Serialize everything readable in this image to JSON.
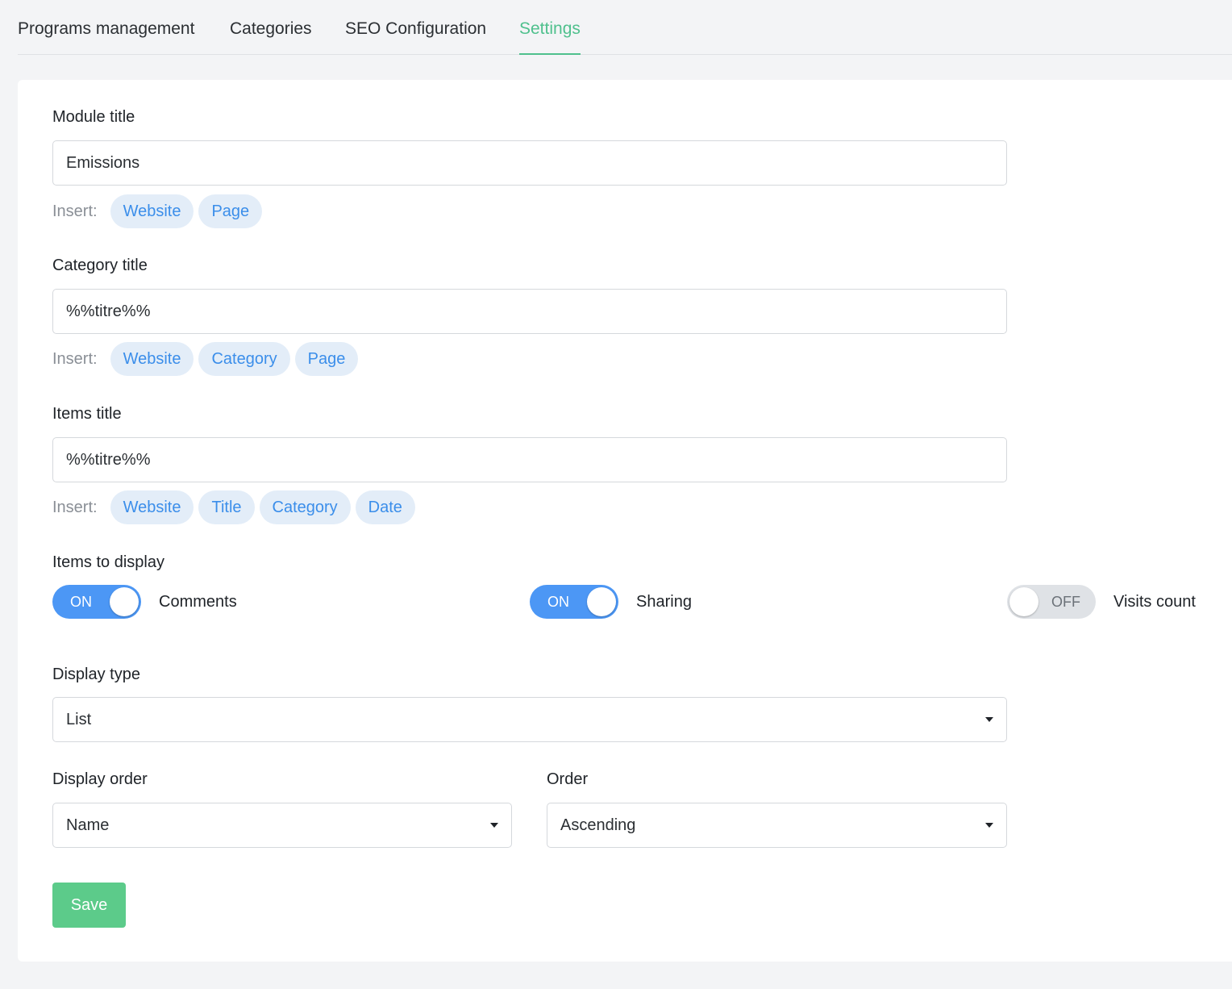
{
  "tabs": [
    {
      "label": "Programs management",
      "active": false
    },
    {
      "label": "Categories",
      "active": false
    },
    {
      "label": "SEO Configuration",
      "active": false
    },
    {
      "label": "Settings",
      "active": true
    }
  ],
  "colors": {
    "accent_green": "#4fc08d",
    "chip_bg": "#e3edf8",
    "chip_text": "#3b8eea",
    "toggle_on": "#4c97f5",
    "toggle_off": "#dfe2e6",
    "save_button": "#5ccb8a"
  },
  "form": {
    "module_title": {
      "label": "Module title",
      "value": "Emissions",
      "insert_label": "Insert:",
      "chips": [
        "Website",
        "Page"
      ]
    },
    "category_title": {
      "label": "Category title",
      "value": "%%titre%%",
      "insert_label": "Insert:",
      "chips": [
        "Website",
        "Category",
        "Page"
      ]
    },
    "items_title": {
      "label": "Items title",
      "value": "%%titre%%",
      "insert_label": "Insert:",
      "chips": [
        "Website",
        "Title",
        "Category",
        "Date"
      ]
    },
    "items_to_display": {
      "label": "Items to display",
      "toggles": [
        {
          "label": "Comments",
          "on": true,
          "state": "ON"
        },
        {
          "label": "Sharing",
          "on": true,
          "state": "ON"
        },
        {
          "label": "Visits count",
          "on": false,
          "state": "OFF"
        }
      ]
    },
    "display_type": {
      "label": "Display type",
      "value": "List"
    },
    "display_order": {
      "label": "Display order",
      "value": "Name"
    },
    "order": {
      "label": "Order",
      "value": "Ascending"
    },
    "save_label": "Save"
  }
}
